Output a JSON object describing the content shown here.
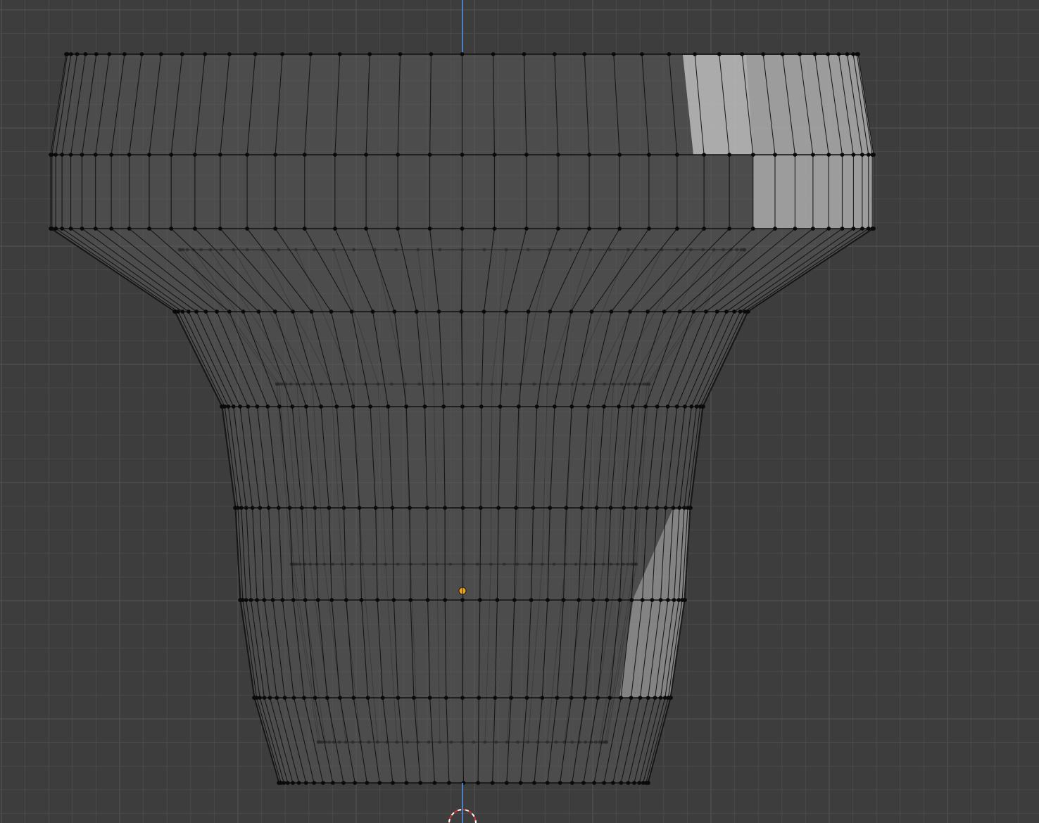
{
  "viewport": {
    "name": "3D Viewport",
    "view": "front-orthographic",
    "mode": "edit-mode-wireframe-xray",
    "colors": {
      "background": "#3d3d3d",
      "grid_minor": "#4a4a4a",
      "grid_major": "#555555",
      "z_axis": "#4d7fc4",
      "mesh_wire": "#111111",
      "mesh_vertex": "#0a0a0a",
      "mesh_face": "#5a5a5a",
      "highlight_face": "#c8c8c8",
      "origin": "#f5a21b",
      "cursor_red": "#d9312b",
      "cursor_white": "#ffffff"
    },
    "icons": {
      "object_origin": "origin-dot-icon",
      "cursor": "3d-cursor-icon"
    }
  },
  "mesh": {
    "object_type": "lathe / spin mesh (vase shape)",
    "segments_visible": 40,
    "rings": 9
  }
}
